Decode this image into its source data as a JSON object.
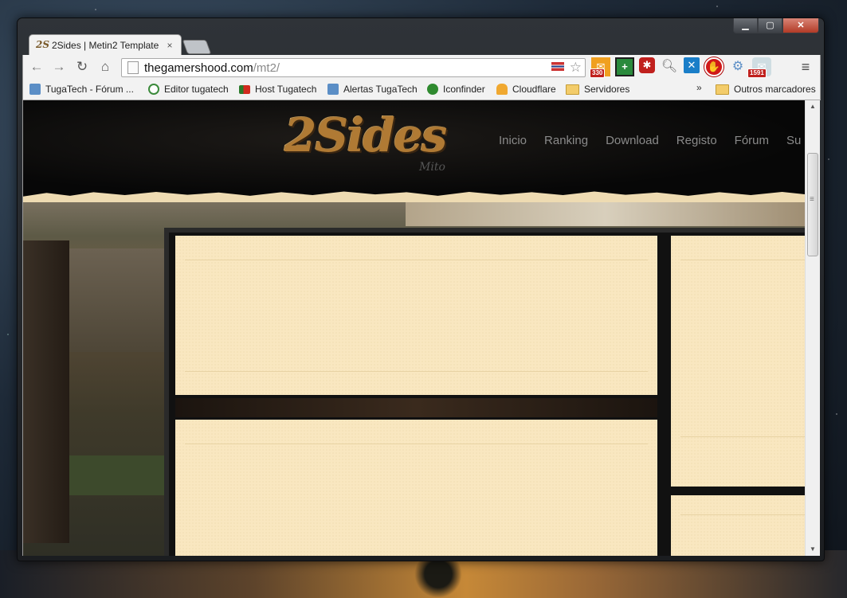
{
  "browser": {
    "tab_title": "2Sides | Metin2 Template",
    "tab_favicon_text": "2S",
    "tab_close": "×",
    "url_host": "thegamershood.com",
    "url_path": "/mt2/",
    "extensions": [
      {
        "name": "mail-extension-icon",
        "badge": "330",
        "color": "#f0a020"
      },
      {
        "name": "plus-extension-icon",
        "badge": "",
        "color": "#2a8a3c"
      },
      {
        "name": "lastpass-extension-icon",
        "badge": "",
        "color": "#c0201d"
      },
      {
        "name": "magnifier-extension-icon",
        "badge": "",
        "color": "#8a8a8a"
      },
      {
        "name": "blue-x-extension-icon",
        "badge": "",
        "color": "#1a7ec8"
      },
      {
        "name": "adblock-extension-icon",
        "badge": "",
        "color": "#d01818"
      },
      {
        "name": "tugatech-extension-icon",
        "badge": "",
        "color": "#5b8ec6"
      },
      {
        "name": "rss-extension-icon",
        "badge": "1591",
        "color": "#9ab0b8"
      }
    ]
  },
  "bookmarks": [
    {
      "label": "TugaTech - Fórum ...",
      "icon": "tugatech-icon",
      "color": "#5b8ec6"
    },
    {
      "label": "Editor tugatech",
      "icon": "editor-icon",
      "color": "#3b8a3b"
    },
    {
      "label": "Host Tugatech",
      "icon": "portugal-flag-icon",
      "color": "#d12a1e"
    },
    {
      "label": "Alertas TugaTech",
      "icon": "alert-icon",
      "color": "#5b8ec6"
    },
    {
      "label": "Iconfinder",
      "icon": "iconfinder-icon",
      "color": "#2f8a2f"
    },
    {
      "label": "Cloudflare",
      "icon": "cloudflare-icon",
      "color": "#f0a830"
    },
    {
      "label": "Servidores",
      "icon": "folder-icon",
      "color": "#f3cc6a"
    }
  ],
  "bookmarks_overflow": "»",
  "other_bookmarks": "Outros marcadores",
  "site": {
    "logo": "2Sides",
    "logo_sub": "Mito",
    "nav": [
      "Inicio",
      "Ranking",
      "Download",
      "Registo",
      "Fórum",
      "Su"
    ]
  }
}
